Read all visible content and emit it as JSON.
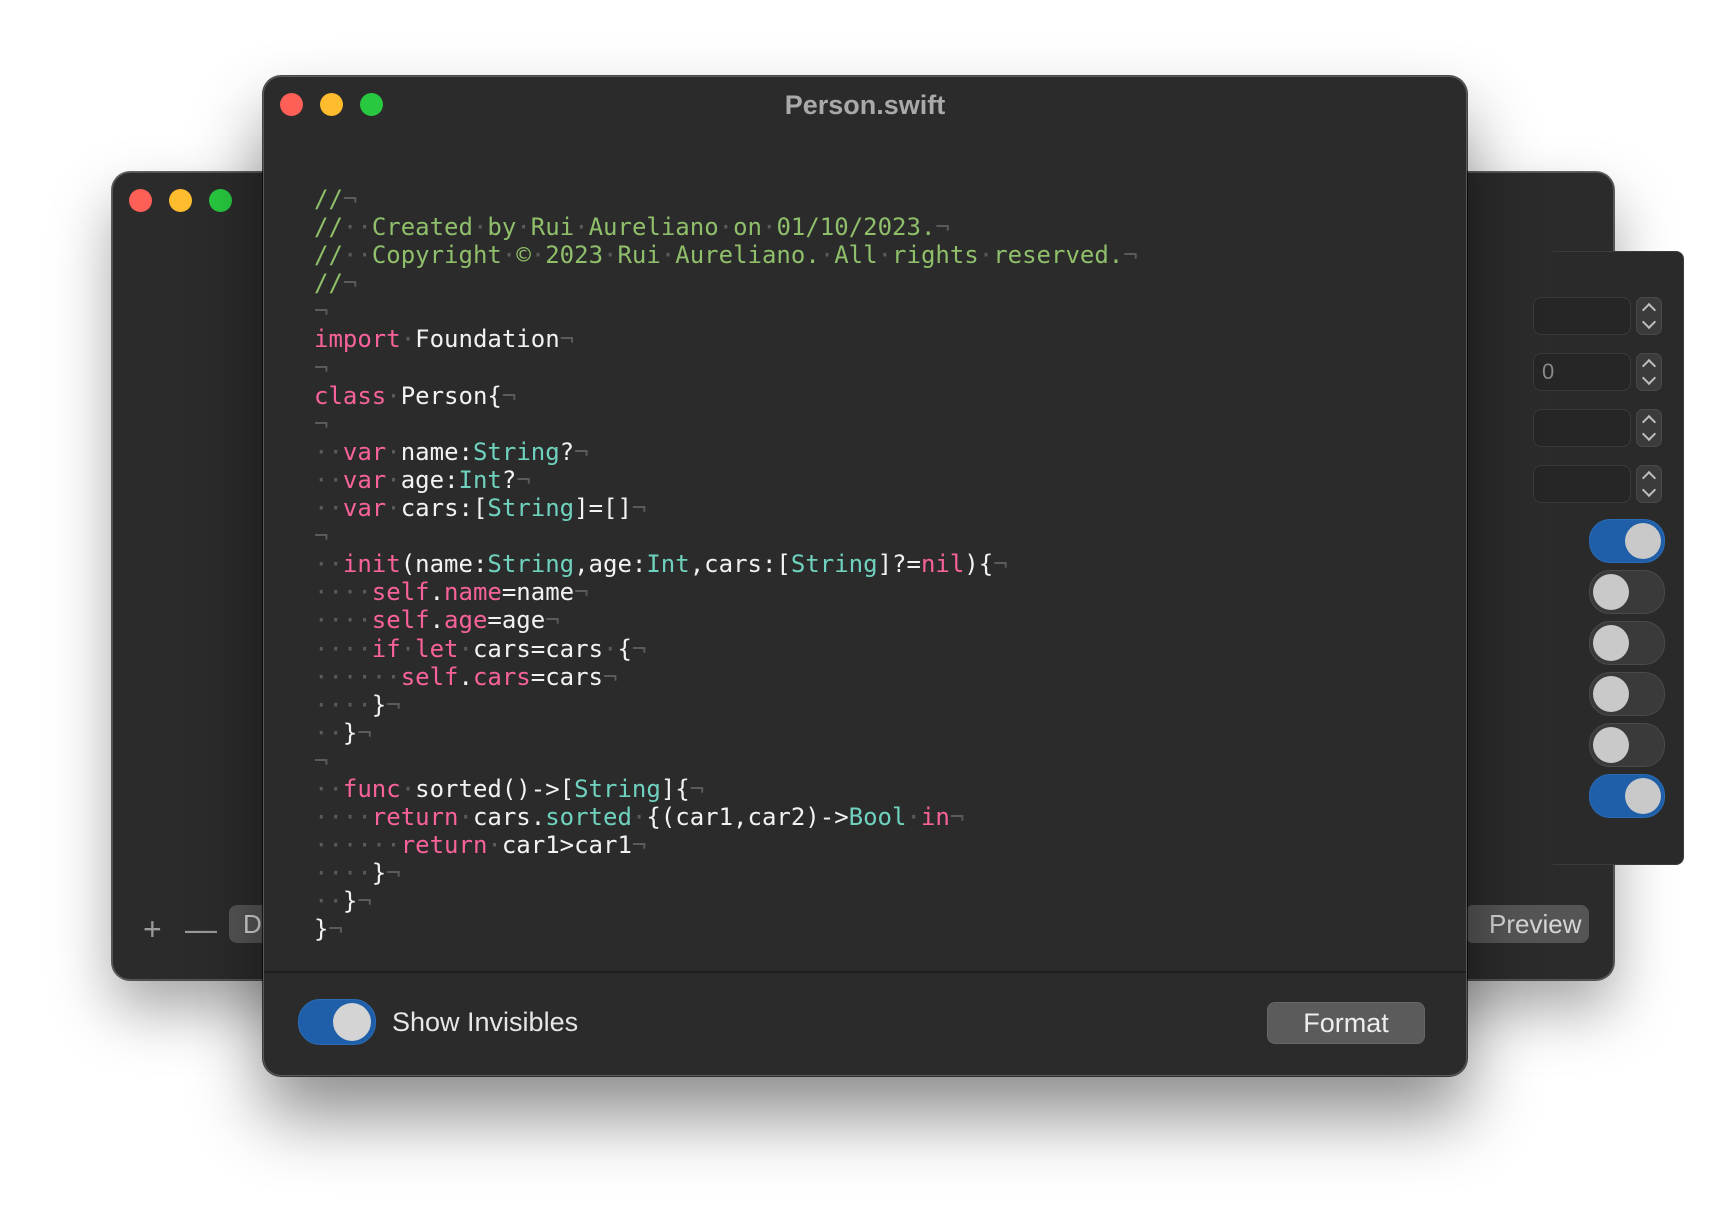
{
  "background_window": {
    "field_value": "0",
    "bg_button_label": "D",
    "preview_label": "Preview",
    "add_symbol": "+",
    "remove_symbol": "—",
    "toggle_states": [
      true,
      false,
      false,
      false,
      false,
      true
    ],
    "stepper_count": 4
  },
  "front_window": {
    "title": "Person.swift",
    "code_lines": [
      [
        [
          "cm",
          "//"
        ],
        [
          "inv",
          "¬"
        ]
      ],
      [
        [
          "cm",
          "//"
        ],
        [
          "inv",
          "··"
        ],
        [
          "cm",
          "Created"
        ],
        [
          "inv",
          "·"
        ],
        [
          "cm",
          "by"
        ],
        [
          "inv",
          "·"
        ],
        [
          "cm",
          "Rui"
        ],
        [
          "inv",
          "·"
        ],
        [
          "cm",
          "Aureliano"
        ],
        [
          "inv",
          "·"
        ],
        [
          "cm",
          "on"
        ],
        [
          "inv",
          "·"
        ],
        [
          "cm",
          "01/10/2023."
        ],
        [
          "inv",
          "¬"
        ]
      ],
      [
        [
          "cm",
          "//"
        ],
        [
          "inv",
          "··"
        ],
        [
          "cm",
          "Copyright"
        ],
        [
          "inv",
          "·"
        ],
        [
          "cm",
          "©"
        ],
        [
          "inv",
          "·"
        ],
        [
          "cm",
          "2023"
        ],
        [
          "inv",
          "·"
        ],
        [
          "cm",
          "Rui"
        ],
        [
          "inv",
          "·"
        ],
        [
          "cm",
          "Aureliano."
        ],
        [
          "inv",
          "·"
        ],
        [
          "cm",
          "All"
        ],
        [
          "inv",
          "·"
        ],
        [
          "cm",
          "rights"
        ],
        [
          "inv",
          "·"
        ],
        [
          "cm",
          "reserved."
        ],
        [
          "inv",
          "¬"
        ]
      ],
      [
        [
          "cm",
          "//"
        ],
        [
          "inv",
          "¬"
        ]
      ],
      [
        [
          "inv",
          "¬"
        ]
      ],
      [
        [
          "kw",
          "import"
        ],
        [
          "inv",
          "·"
        ],
        [
          "pl",
          "Foundation"
        ],
        [
          "inv",
          "¬"
        ]
      ],
      [
        [
          "inv",
          "¬"
        ]
      ],
      [
        [
          "kw",
          "class"
        ],
        [
          "inv",
          "·"
        ],
        [
          "pl",
          "Person{"
        ],
        [
          "inv",
          "¬"
        ]
      ],
      [
        [
          "inv",
          "¬"
        ]
      ],
      [
        [
          "inv",
          "··"
        ],
        [
          "kw",
          "var"
        ],
        [
          "inv",
          "·"
        ],
        [
          "pl",
          "name:"
        ],
        [
          "ty",
          "String"
        ],
        [
          "pl",
          "?"
        ],
        [
          "inv",
          "¬"
        ]
      ],
      [
        [
          "inv",
          "··"
        ],
        [
          "kw",
          "var"
        ],
        [
          "inv",
          "·"
        ],
        [
          "pl",
          "age:"
        ],
        [
          "ty",
          "Int"
        ],
        [
          "pl",
          "?"
        ],
        [
          "inv",
          "¬"
        ]
      ],
      [
        [
          "inv",
          "··"
        ],
        [
          "kw",
          "var"
        ],
        [
          "inv",
          "·"
        ],
        [
          "pl",
          "cars:["
        ],
        [
          "ty",
          "String"
        ],
        [
          "pl",
          "]=[]"
        ],
        [
          "inv",
          "¬"
        ]
      ],
      [
        [
          "inv",
          "¬"
        ]
      ],
      [
        [
          "inv",
          "··"
        ],
        [
          "kw",
          "init"
        ],
        [
          "pl",
          "(name:"
        ],
        [
          "ty",
          "String"
        ],
        [
          "pl",
          ",age:"
        ],
        [
          "ty",
          "Int"
        ],
        [
          "pl",
          ",cars:["
        ],
        [
          "ty",
          "String"
        ],
        [
          "pl",
          "]?="
        ],
        [
          "kw",
          "nil"
        ],
        [
          "pl",
          "){"
        ],
        [
          "inv",
          "¬"
        ]
      ],
      [
        [
          "inv",
          "····"
        ],
        [
          "kw",
          "self"
        ],
        [
          "pl",
          "."
        ],
        [
          "kw",
          "name"
        ],
        [
          "pl",
          "=name"
        ],
        [
          "inv",
          "¬"
        ]
      ],
      [
        [
          "inv",
          "····"
        ],
        [
          "kw",
          "self"
        ],
        [
          "pl",
          "."
        ],
        [
          "kw",
          "age"
        ],
        [
          "pl",
          "=age"
        ],
        [
          "inv",
          "¬"
        ]
      ],
      [
        [
          "inv",
          "····"
        ],
        [
          "kw",
          "if"
        ],
        [
          "inv",
          "·"
        ],
        [
          "kw",
          "let"
        ],
        [
          "inv",
          "·"
        ],
        [
          "pl",
          "cars=cars"
        ],
        [
          "inv",
          "·"
        ],
        [
          "pl",
          "{"
        ],
        [
          "inv",
          "¬"
        ]
      ],
      [
        [
          "inv",
          "······"
        ],
        [
          "kw",
          "self"
        ],
        [
          "pl",
          "."
        ],
        [
          "kw",
          "cars"
        ],
        [
          "pl",
          "=cars"
        ],
        [
          "inv",
          "¬"
        ]
      ],
      [
        [
          "inv",
          "····"
        ],
        [
          "pl",
          "}"
        ],
        [
          "inv",
          "¬"
        ]
      ],
      [
        [
          "inv",
          "··"
        ],
        [
          "pl",
          "}"
        ],
        [
          "inv",
          "¬"
        ]
      ],
      [
        [
          "inv",
          "¬"
        ]
      ],
      [
        [
          "inv",
          "··"
        ],
        [
          "kw",
          "func"
        ],
        [
          "inv",
          "·"
        ],
        [
          "pl",
          "sorted()->["
        ],
        [
          "ty",
          "String"
        ],
        [
          "pl",
          "]{"
        ],
        [
          "inv",
          "¬"
        ]
      ],
      [
        [
          "inv",
          "····"
        ],
        [
          "kw",
          "return"
        ],
        [
          "inv",
          "·"
        ],
        [
          "pl",
          "cars."
        ],
        [
          "ty",
          "sorted"
        ],
        [
          "inv",
          "·"
        ],
        [
          "pl",
          "{(car1,car2)->"
        ],
        [
          "ty",
          "Bool"
        ],
        [
          "inv",
          "·"
        ],
        [
          "kw",
          "in"
        ],
        [
          "inv",
          "¬"
        ]
      ],
      [
        [
          "inv",
          "······"
        ],
        [
          "kw",
          "return"
        ],
        [
          "inv",
          "·"
        ],
        [
          "pl",
          "car1>car1"
        ],
        [
          "inv",
          "¬"
        ]
      ],
      [
        [
          "inv",
          "····"
        ],
        [
          "pl",
          "}"
        ],
        [
          "inv",
          "¬"
        ]
      ],
      [
        [
          "inv",
          "··"
        ],
        [
          "pl",
          "}"
        ],
        [
          "inv",
          "¬"
        ]
      ],
      [
        [
          "pl",
          "}"
        ],
        [
          "inv",
          "¬"
        ]
      ]
    ],
    "footer": {
      "show_invisibles_label": "Show Invisibles",
      "show_invisibles_on": true,
      "format_label": "Format"
    }
  },
  "colors": {
    "comment": "#8fbf6a",
    "keyword": "#f7629a",
    "type": "#6fd2be",
    "plain": "#f2f2f2",
    "invisible": "#5b5b5b",
    "toggle_on": "#1f5fa9",
    "window_bg": "#2b2b2b"
  }
}
